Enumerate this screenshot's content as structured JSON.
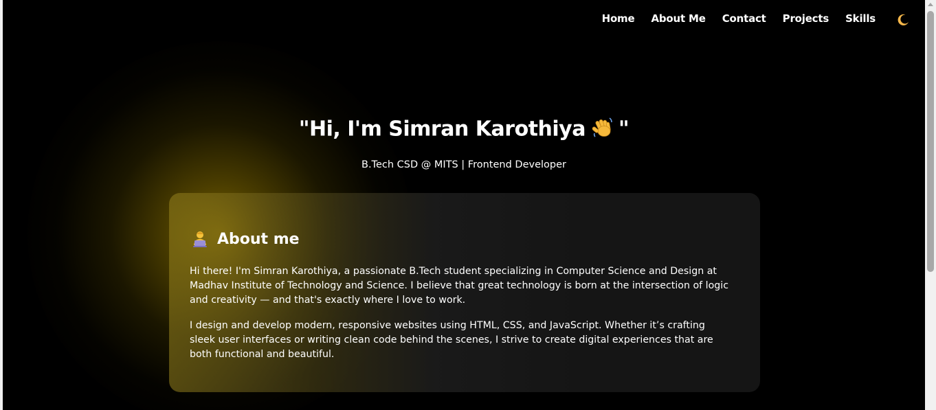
{
  "nav": {
    "links": [
      "Home",
      "About Me",
      "Contact",
      "Projects",
      "Skills"
    ],
    "theme_toggle_icon": "moon-icon"
  },
  "hero": {
    "title_prefix": "\"Hi, I'm Simran Karothiya",
    "title_icon": "waving-hand-icon",
    "title_suffix": "\"",
    "subtitle": "B.Tech CSD @ MITS | Frontend Developer"
  },
  "about": {
    "heading_icon": "technologist-icon",
    "heading": "About me",
    "paragraphs": [
      "Hi there! I'm Simran Karothiya, a passionate B.Tech student specializing in Computer Science and Design at Madhav Institute of Technology and Science. I believe that great technology is born at the intersection of logic and creativity — and that's exactly where I love to work.",
      "I design and develop modern, responsive websites using HTML, CSS, and JavaScript. Whether it’s crafting sleek user interfaces or writing clean code behind the scenes, I strive to create digital experiences that are both functional and beautiful."
    ]
  },
  "colors": {
    "background": "#000000",
    "glow": "#806800",
    "card": "#161616",
    "text": "#ffffff",
    "moon": "#f5b74a"
  }
}
